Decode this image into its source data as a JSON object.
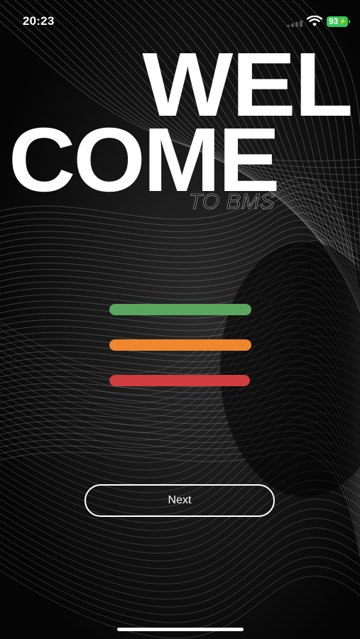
{
  "status_bar": {
    "time": "20:23",
    "battery_level": "93",
    "battery_color": "#34c759",
    "icons": [
      "signal-icon",
      "wifi-icon",
      "battery-icon",
      "charging-bolt-icon"
    ]
  },
  "hero": {
    "line1": "WEL",
    "line2": "COME",
    "subtitle": "TO BMS"
  },
  "status_bars": [
    {
      "name": "green",
      "color": "#5aa65e"
    },
    {
      "name": "orange",
      "color": "#f0872f"
    },
    {
      "name": "red",
      "color": "#cf3d3f"
    }
  ],
  "actions": {
    "next_label": "Next"
  },
  "theme": {
    "background": "#050505",
    "text": "#ffffff"
  }
}
